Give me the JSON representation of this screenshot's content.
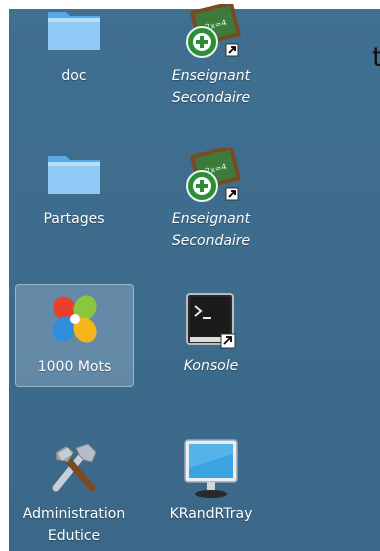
{
  "desktop": {
    "clipped_text": "t",
    "icons": [
      {
        "name": "doc",
        "line1": "doc",
        "line2": "",
        "type": "folder"
      },
      {
        "name": "enseignant-secondaire-1",
        "line1": "Enseignant",
        "line2": "Secondaire",
        "type": "chalkboard-shortcut"
      },
      {
        "name": "partages",
        "line1": "Partages",
        "line2": "",
        "type": "folder"
      },
      {
        "name": "enseignant-secondaire-2",
        "line1": "Enseignant",
        "line2": "Secondaire",
        "type": "chalkboard-shortcut"
      },
      {
        "name": "1000-mots",
        "line1": "1000 Mots",
        "line2": "",
        "type": "flower-app"
      },
      {
        "name": "konsole",
        "line1": "Konsole",
        "line2": "",
        "type": "terminal-shortcut"
      },
      {
        "name": "administration-edutice",
        "line1": "Administration",
        "line2": "Edutice",
        "type": "tools"
      },
      {
        "name": "krandrtray",
        "line1": "KRandRTray",
        "line2": "",
        "type": "monitor"
      }
    ]
  }
}
